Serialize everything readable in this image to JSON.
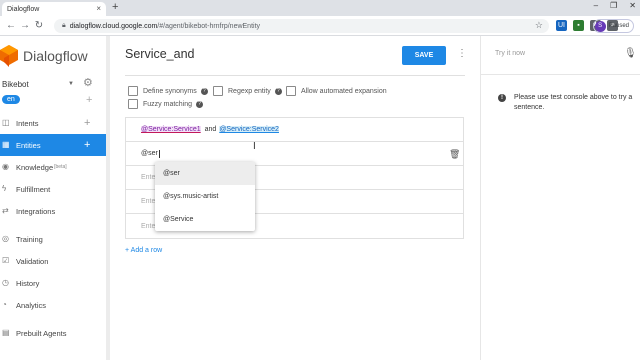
{
  "browser": {
    "tab_title": "Dialogflow",
    "tab_close": "×",
    "new_tab": "+",
    "win_minimize": "–",
    "win_maximize": "❐",
    "win_close": "✕",
    "back": "←",
    "forward": "→",
    "reload": "↻",
    "url_host": "dialogflow.cloud.google.com",
    "url_path": "/#/agent/bikebot-hrnfrp/newEntity",
    "profile_initial": "S",
    "profile_status": "Paused",
    "extensions": [
      {
        "name": "ui-extension-icon",
        "label": "UI",
        "color": "#1565c0"
      },
      {
        "name": "green-extension-icon",
        "label": "▪",
        "color": "#2e7d32"
      },
      {
        "name": "puzzle-extension-icon",
        "label": "✱",
        "color": "#5f6368"
      },
      {
        "name": "playlist-icon",
        "label": "≡",
        "color": "#5f6368"
      }
    ]
  },
  "sidebar": {
    "brand": "Dialogflow",
    "agent_name": "Bikebot",
    "language": "en",
    "items": [
      {
        "label": "Intents",
        "icon": "◫",
        "plus": "+",
        "active": false
      },
      {
        "label": "Entities",
        "icon": "▦",
        "plus": "+",
        "active": true
      },
      {
        "label": "Knowledge",
        "badge": "[beta]",
        "icon": "◉"
      },
      {
        "label": "Fulfillment",
        "icon": "ϟ"
      },
      {
        "label": "Integrations",
        "icon": "⇄"
      },
      {
        "label": "Training",
        "icon": "◎"
      },
      {
        "label": "Validation",
        "icon": "☑"
      },
      {
        "label": "History",
        "icon": "◷"
      },
      {
        "label": "Analytics",
        "icon": "◔"
      },
      {
        "label": "Prebuilt Agents",
        "icon": "▤"
      }
    ]
  },
  "main": {
    "entity_name": "Service_and",
    "save_label": "SAVE",
    "options": {
      "define_synonyms": "Define synonyms",
      "regexp_entity": "Regexp entity",
      "allow_expansion": "Allow automated expansion",
      "fuzzy_matching": "Fuzzy matching"
    },
    "rows": {
      "row1_ref1": "@Service:Service1",
      "row1_conj": "and",
      "row1_ref2": "@Service:Service2",
      "row2_value": "@ser",
      "placeholder": "Enter"
    },
    "add_row": "+ Add a row",
    "autocomplete": [
      "@ser",
      "@sys.music-artist",
      "@Service"
    ]
  },
  "test_console": {
    "placeholder": "Try it now",
    "info_text": "Please use test console above to try a sentence."
  }
}
